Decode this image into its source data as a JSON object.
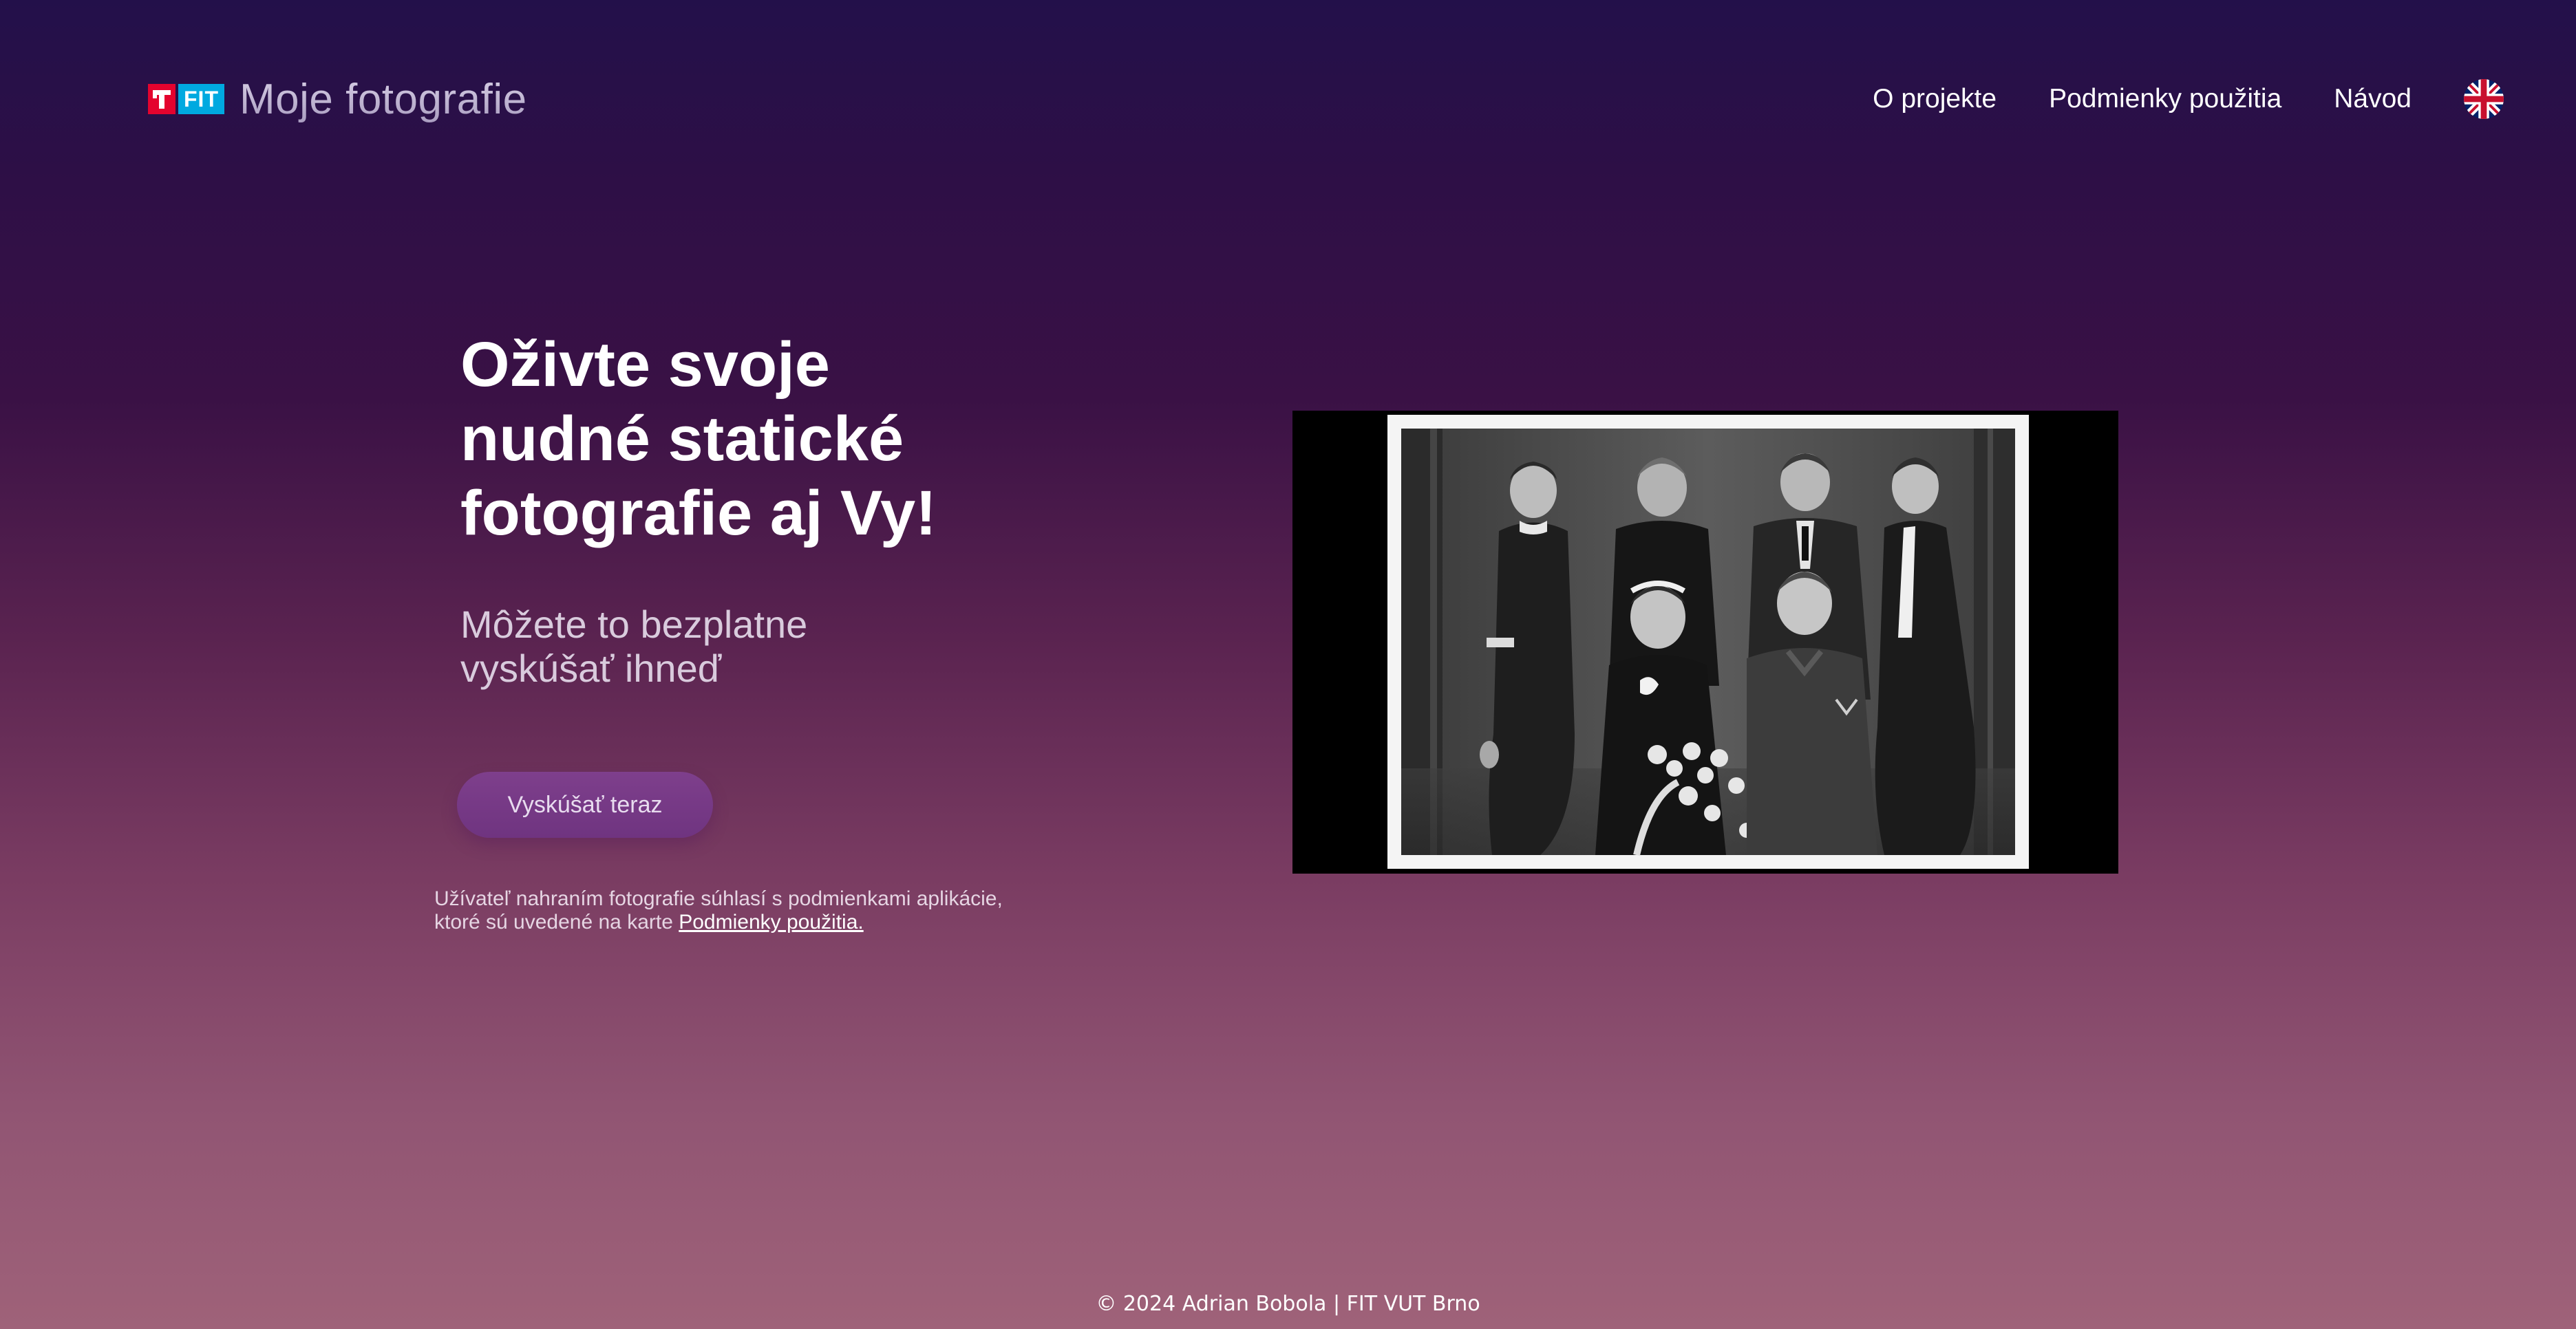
{
  "header": {
    "logo_badge_letter": "T",
    "logo_badge_text": "FIT",
    "logo_title": "Moje fotografie",
    "nav": {
      "about": "O projekte",
      "terms": "Podmienky použitia",
      "guide": "Návod"
    },
    "language_icon": "uk-flag-icon"
  },
  "hero": {
    "title": "Oživte svoje nudné statické fotografie aj Vy!",
    "subtitle": "Môžete to bezplatne vyskúšať ihneď",
    "cta_label": "Vyskúšať teraz",
    "notice_text": "Užívateľ nahraním fotografie súhlasí s podmienkami aplikácie, ktoré sú uvedené na karte ",
    "notice_link": "Podmienky použitia."
  },
  "photo": {
    "subject": "black-and-white wedding family portrait"
  },
  "footer": {
    "copyright": "© 2024 Adrian Bobola | FIT VUT Brno"
  },
  "colors": {
    "brand_red": "#e4032e",
    "brand_blue": "#00a9e0",
    "button": "#7a3b89",
    "background_top": "#23104a",
    "background_bottom": "#9f6279"
  }
}
